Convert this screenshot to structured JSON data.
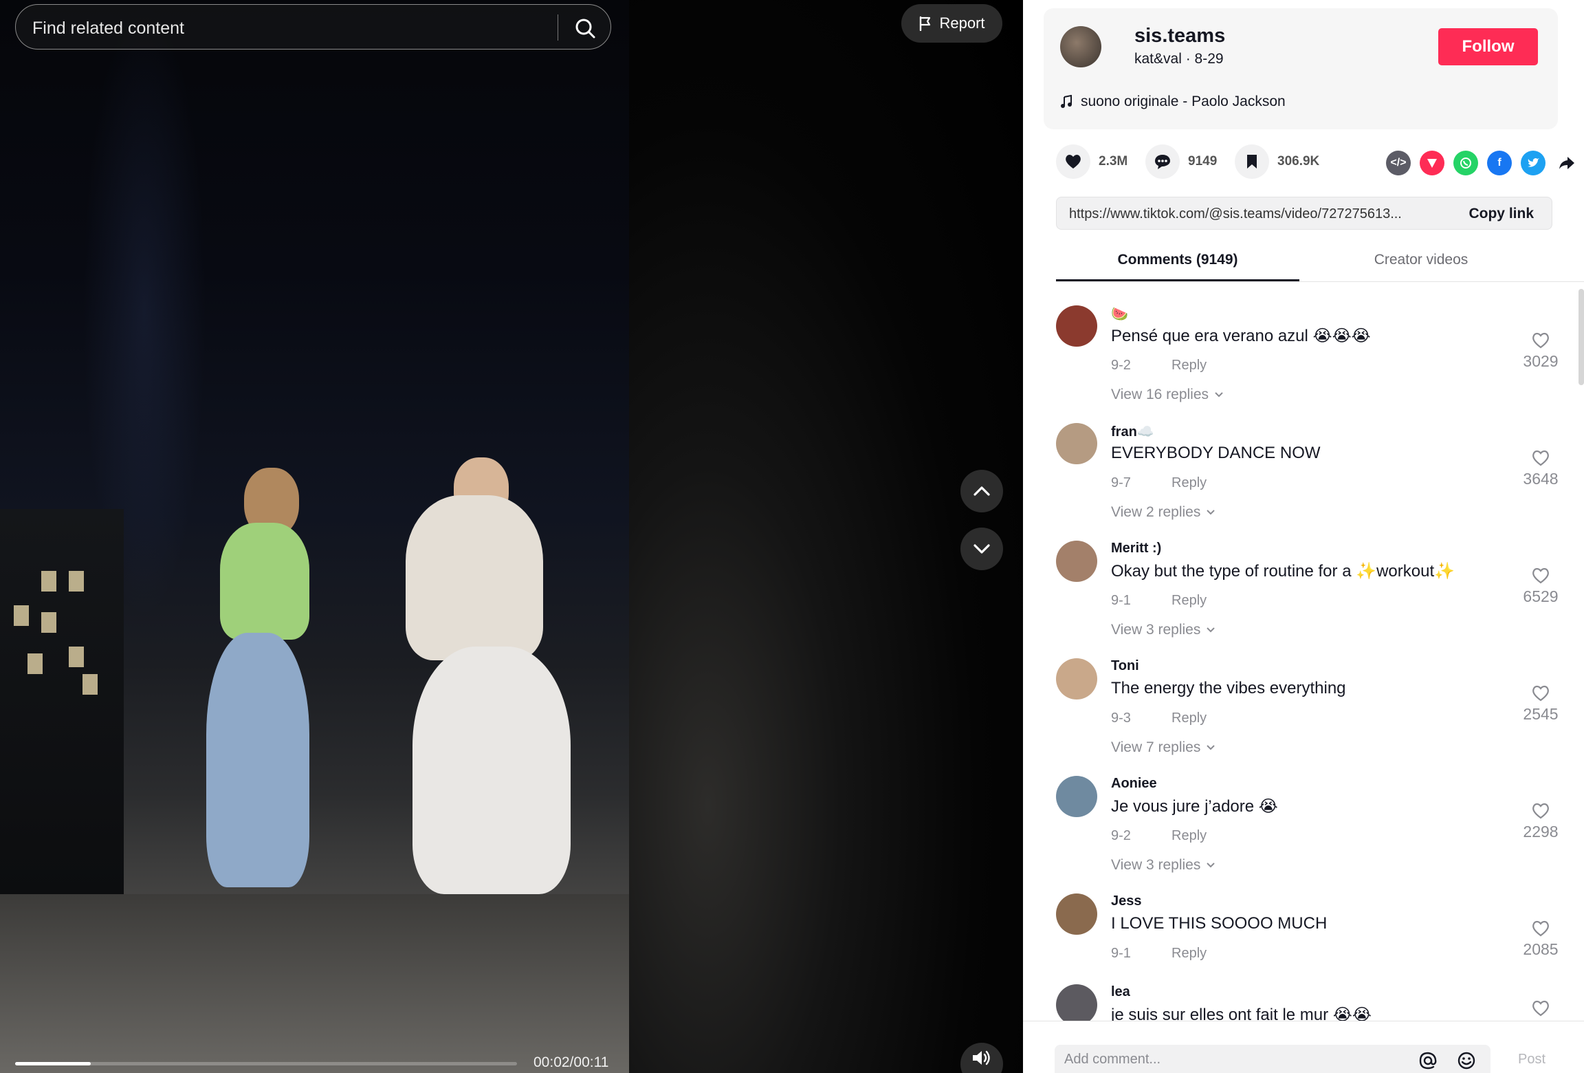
{
  "search": {
    "placeholder": "Find related content"
  },
  "video": {
    "report_label": "Report",
    "time": "00:02/00:11",
    "progress_fraction": 0.15
  },
  "author": {
    "username": "sis.teams",
    "nickname_date": "kat&val · 8-29",
    "follow_label": "Follow",
    "music": "suono originale - Paolo Jackson"
  },
  "stats": {
    "likes": "2.3M",
    "comments": "9149",
    "saves": "306.9K"
  },
  "share": {
    "link": "https://www.tiktok.com/@sis.teams/video/727275613...",
    "copy_label": "Copy link",
    "icons": [
      "embed-icon",
      "send-icon",
      "whatsapp-icon",
      "facebook-icon",
      "twitter-icon",
      "share-arrow-icon"
    ]
  },
  "tabs": {
    "comments": "Comments (9149)",
    "creator": "Creator videos"
  },
  "comments": [
    {
      "user": "🍉",
      "text": "Pensé que era verano azul 😭😭😭",
      "date": "9-2",
      "reply": "Reply",
      "view": "View 16 replies",
      "likes": "3029",
      "avatar": "#8b3a2e"
    },
    {
      "user": "fran☁️",
      "text": "EVERYBODY DANCE NOW",
      "date": "9-7",
      "reply": "Reply",
      "view": "View 2 replies",
      "likes": "3648",
      "avatar": "#b59b82"
    },
    {
      "user": "Meritt :)",
      "text": "Okay but the type of routine for a ✨workout✨",
      "date": "9-1",
      "reply": "Reply",
      "view": "View 3 replies",
      "likes": "6529",
      "avatar": "#a3806a"
    },
    {
      "user": "Toni",
      "text": "The energy the vibes everything",
      "date": "9-3",
      "reply": "Reply",
      "view": "View 7 replies",
      "likes": "2545",
      "avatar": "#c9a88a"
    },
    {
      "user": "Aoniee",
      "text": "Je vous jure j’adore 😭",
      "date": "9-2",
      "reply": "Reply",
      "view": "View 3 replies",
      "likes": "2298",
      "avatar": "#6f8aa0"
    },
    {
      "user": "Jess",
      "text": "I LOVE THIS SOOOO MUCH",
      "date": "9-1",
      "reply": "Reply",
      "view": "",
      "likes": "2085",
      "avatar": "#8a6a4e"
    },
    {
      "user": "lea",
      "text": "je suis sur elles ont fait le mur 😭😭",
      "date": "",
      "reply": "",
      "view": "",
      "likes": "",
      "avatar": "#5c5a60"
    }
  ],
  "composer": {
    "placeholder": "Add comment...",
    "post_label": "Post"
  },
  "colors": {
    "accent": "#fe2c55",
    "text": "#161823",
    "muted": "#8a8b91"
  }
}
